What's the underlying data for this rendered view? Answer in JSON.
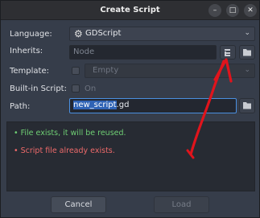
{
  "window": {
    "title": "Create Script",
    "controls": [
      "minimize-icon",
      "maximize-icon",
      "close-icon"
    ]
  },
  "form": {
    "language_label": "Language:",
    "language_value": "GDScript",
    "inherits_label": "Inherits:",
    "inherits_value": "Node",
    "template_label": "Template:",
    "template_value": "Empty",
    "builtin_label": "Built-in Script:",
    "builtin_value": "On",
    "path_label": "Path:",
    "path_selected": "new_script",
    "path_rest": ".gd"
  },
  "messages": {
    "ok": "• File exists, it will be reused.",
    "error": "• Script file already exists."
  },
  "buttons": {
    "cancel": "Cancel",
    "load": "Load"
  },
  "colors": {
    "annotation": "#e0141c",
    "ok": "#6fcf74",
    "error": "#ee6a6a",
    "focus": "#4a8fe0"
  }
}
